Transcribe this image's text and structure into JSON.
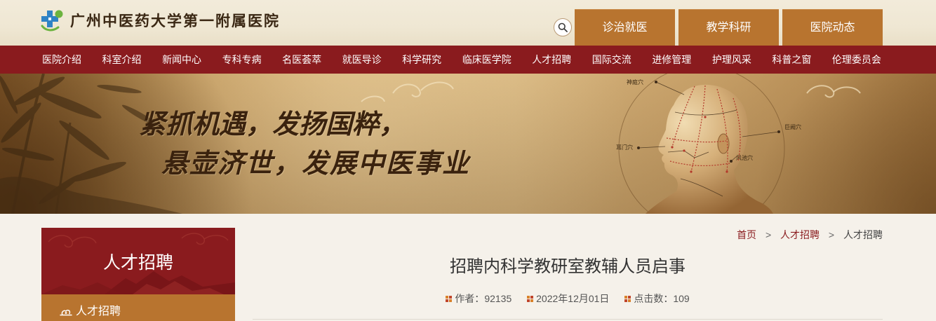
{
  "colors": {
    "header_bg": "#efe7d3",
    "maroon": "#8a1b1e",
    "bronze": "#b8742f",
    "page_bg": "#f5f1ea"
  },
  "header": {
    "logo_icon": "hospital-logo-icon",
    "hospital_name": "广州中医药大学第一附属医院",
    "search_icon": "search-icon",
    "quick_links": [
      {
        "label": "诊治就医"
      },
      {
        "label": "教学科研"
      },
      {
        "label": "医院动态"
      }
    ]
  },
  "nav": {
    "items": [
      {
        "label": "医院介绍"
      },
      {
        "label": "科室介绍"
      },
      {
        "label": "新闻中心"
      },
      {
        "label": "专科专病"
      },
      {
        "label": "名医荟萃"
      },
      {
        "label": "就医导诊"
      },
      {
        "label": "科学研究"
      },
      {
        "label": "临床医学院"
      },
      {
        "label": "人才招聘"
      },
      {
        "label": "国际交流"
      },
      {
        "label": "进修管理"
      },
      {
        "label": "护理风采"
      },
      {
        "label": "科普之窗"
      },
      {
        "label": "伦理委员会"
      }
    ]
  },
  "banner": {
    "slogan_line1": "紧抓机遇，发扬国粹，",
    "slogan_line2": "悬壶济世，发展中医事业",
    "acupoints": [
      "神庭穴",
      "巨阙穴",
      "耳门穴",
      "风池穴"
    ]
  },
  "sidebar": {
    "title": "人才招聘",
    "items": [
      {
        "label": "人才招聘",
        "icon": "cloud-icon"
      }
    ]
  },
  "breadcrumb": {
    "items": [
      "首页",
      "人才招聘",
      "人才招聘"
    ],
    "separator": ">"
  },
  "article": {
    "title": "招聘内科学教研室教辅人员启事",
    "meta": {
      "icon": "meta-dot-icon",
      "author_label": "作者：",
      "author": "92135",
      "date": "2022年12月01日",
      "clicks_label": "点击数：",
      "clicks": "109"
    }
  }
}
